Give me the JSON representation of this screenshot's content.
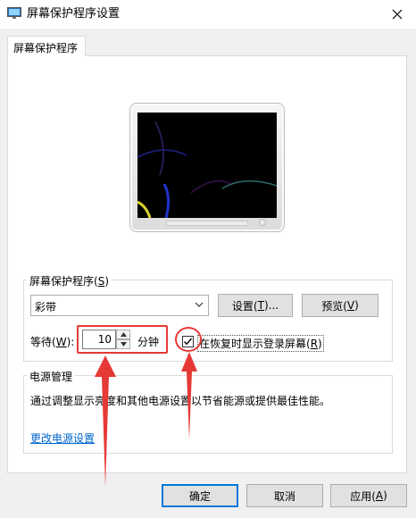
{
  "window": {
    "title": "屏幕保护程序设置",
    "icon": "monitor-settings-icon"
  },
  "tab": {
    "label": "屏幕保护程序"
  },
  "screensaver_group": {
    "label_text": "屏幕保护程序(",
    "label_key": "S",
    "label_end": ")",
    "selected": "彩带",
    "settings_button": {
      "text": "设置(",
      "key": "T",
      "end": ")..."
    },
    "preview_button": {
      "text": "预览(",
      "key": "V",
      "end": ")"
    },
    "wait_label": {
      "text": "等待(",
      "key": "W",
      "end": "):"
    },
    "wait_value": "10",
    "unit": "分钟",
    "resume_checkbox": {
      "checked": true,
      "text": "在恢复时显示登录屏幕(",
      "key": "R",
      "end": ")"
    }
  },
  "power_group": {
    "label": "电源管理",
    "description": "通过调整显示亮度和其他电源设置以节省能源或提供最佳性能。",
    "link": "更改电源设置"
  },
  "buttons": {
    "ok": "确定",
    "cancel": "取消",
    "apply": {
      "text": "应用(",
      "key": "A",
      "end": ")"
    }
  },
  "colors": {
    "annotation": "#e53935",
    "link": "#0066cc",
    "default_border": "#0078d7"
  }
}
